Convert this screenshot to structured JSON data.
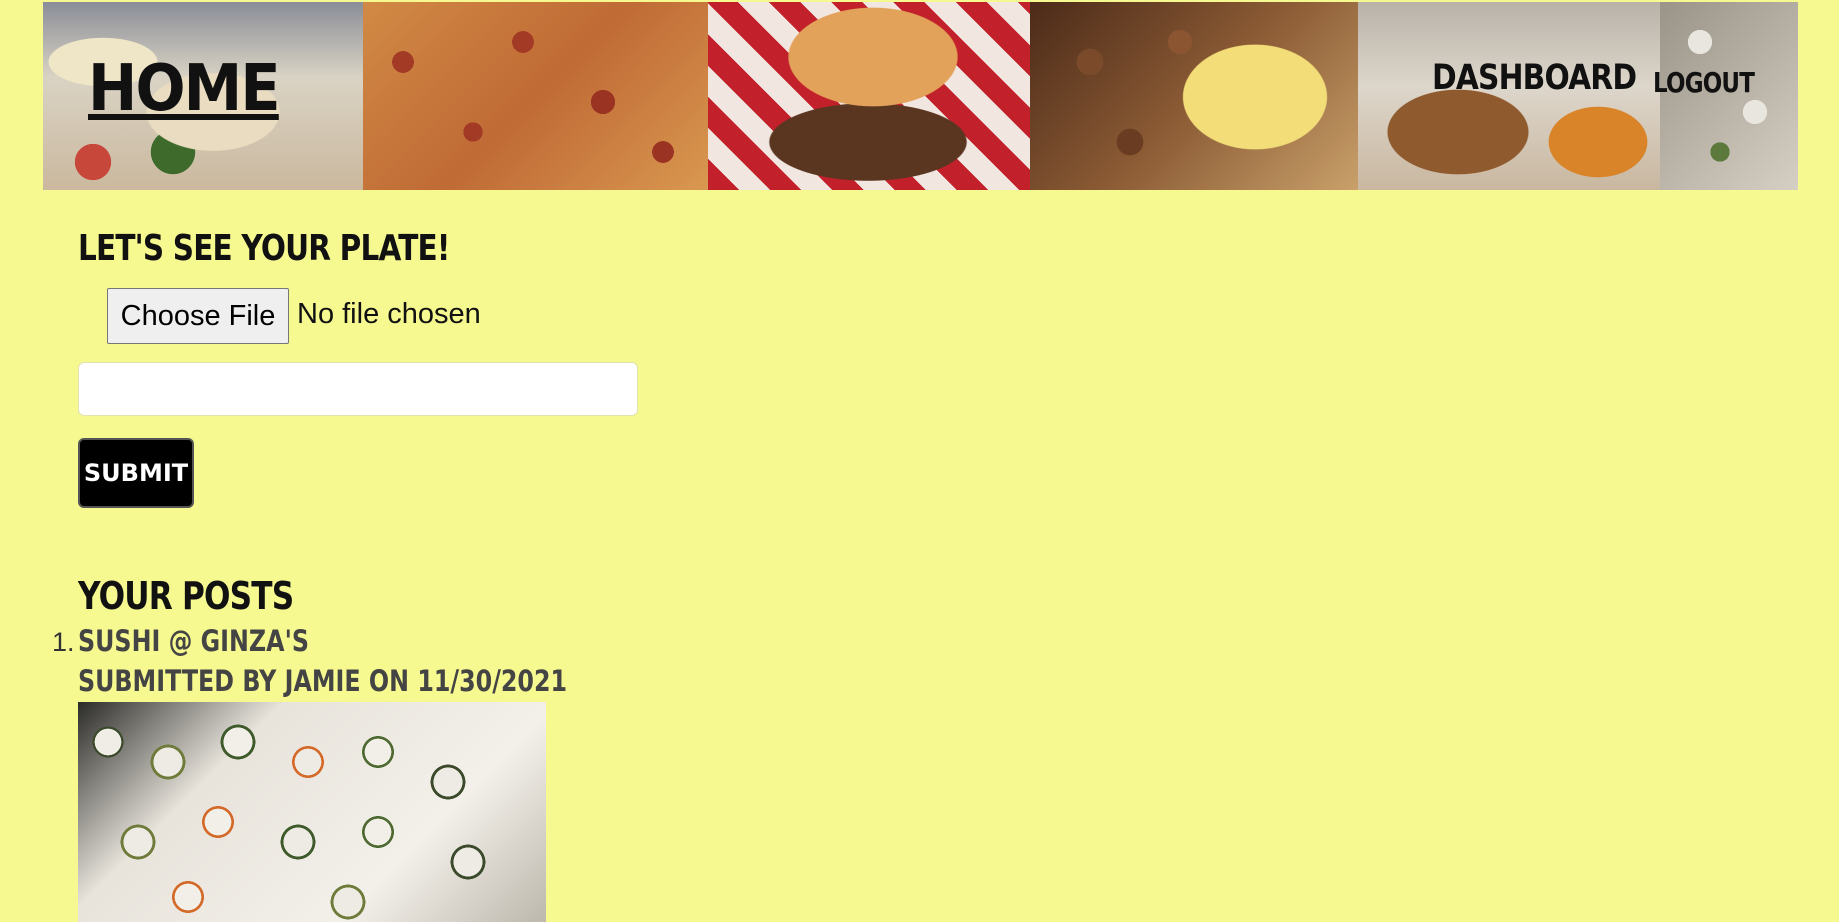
{
  "nav": {
    "home_label": "HOME",
    "dashboard_label": "DASHBOARD",
    "logout_label": "LOGOUT"
  },
  "banner": {
    "photos": [
      "pasta-photo",
      "pizza-photo",
      "burger-photo",
      "hash-browns-eggs-photo",
      "noodles-fries-photo",
      "sushi-photo"
    ]
  },
  "upload": {
    "heading": "LET'S SEE YOUR PLATE!",
    "choose_file_label": "Choose File",
    "file_status": "No file chosen",
    "caption_value": "",
    "submit_label": "SUBMIT"
  },
  "posts": {
    "heading": "YOUR POSTS",
    "items": [
      {
        "number": "1.",
        "title": "SUSHI @ GINZA'S",
        "meta": "SUBMITTED BY JAMIE ON 11/30/2021",
        "image": "sushi-platter-photo"
      }
    ]
  },
  "colors": {
    "background": "#f6f890",
    "text": "#111111",
    "submit_bg": "#000000"
  }
}
